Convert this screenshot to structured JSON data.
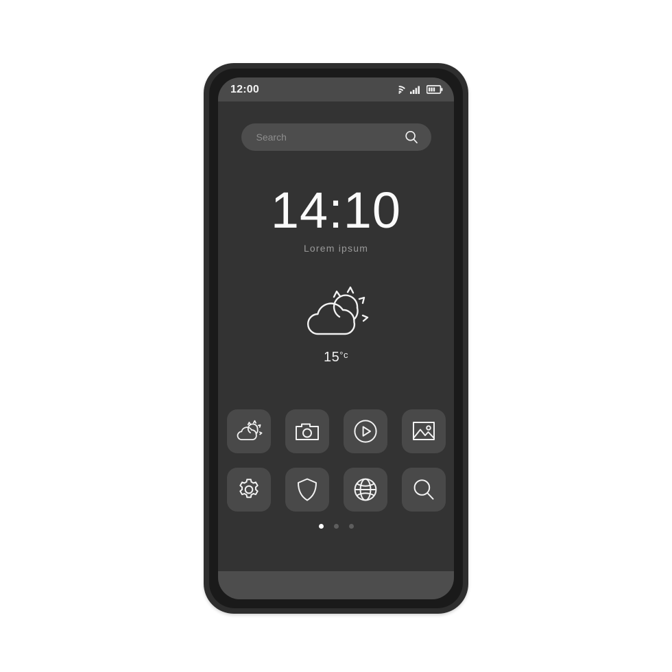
{
  "theme": {
    "page_background": "#ffffff",
    "frame_color": "#2e2e2e",
    "frame_ring_color": "#1a1a1a",
    "screen_background": "#333333",
    "status_bar_background": "#4a4a4a",
    "tile_background": "#494949",
    "accent_text": "#fafafa",
    "muted_text": "#9a9a9a",
    "dock_background": "#4d4d4d"
  },
  "status_bar": {
    "time": "12:00",
    "icons": [
      {
        "name": "wifi-icon",
        "label": "wifi"
      },
      {
        "name": "cellular-signal-icon",
        "label": "signal"
      },
      {
        "name": "battery-icon",
        "label": "battery"
      }
    ]
  },
  "search": {
    "placeholder": "Search",
    "value": "",
    "icon": "search-icon"
  },
  "clock": {
    "time": "14:10",
    "subtitle": "Lorem ipsum"
  },
  "weather": {
    "icon": "sun-behind-cloud-icon",
    "temperature": "15",
    "degree_symbol": "°c"
  },
  "app_grid": {
    "rows": 2,
    "columns": 4,
    "apps": [
      {
        "name": "app-tile-weather",
        "icon": "sun-behind-cloud-icon",
        "label": "Weather"
      },
      {
        "name": "app-tile-camera",
        "icon": "camera-icon",
        "label": "Camera"
      },
      {
        "name": "app-tile-video",
        "icon": "play-circle-icon",
        "label": "Video"
      },
      {
        "name": "app-tile-gallery",
        "icon": "image-icon",
        "label": "Gallery"
      },
      {
        "name": "app-tile-settings",
        "icon": "gear-icon",
        "label": "Settings"
      },
      {
        "name": "app-tile-security",
        "icon": "shield-icon",
        "label": "Security"
      },
      {
        "name": "app-tile-browser",
        "icon": "globe-icon",
        "label": "Browser"
      },
      {
        "name": "app-tile-search",
        "icon": "search-icon",
        "label": "Search"
      }
    ]
  },
  "page_indicator": {
    "total": 3,
    "active_index": 0
  }
}
